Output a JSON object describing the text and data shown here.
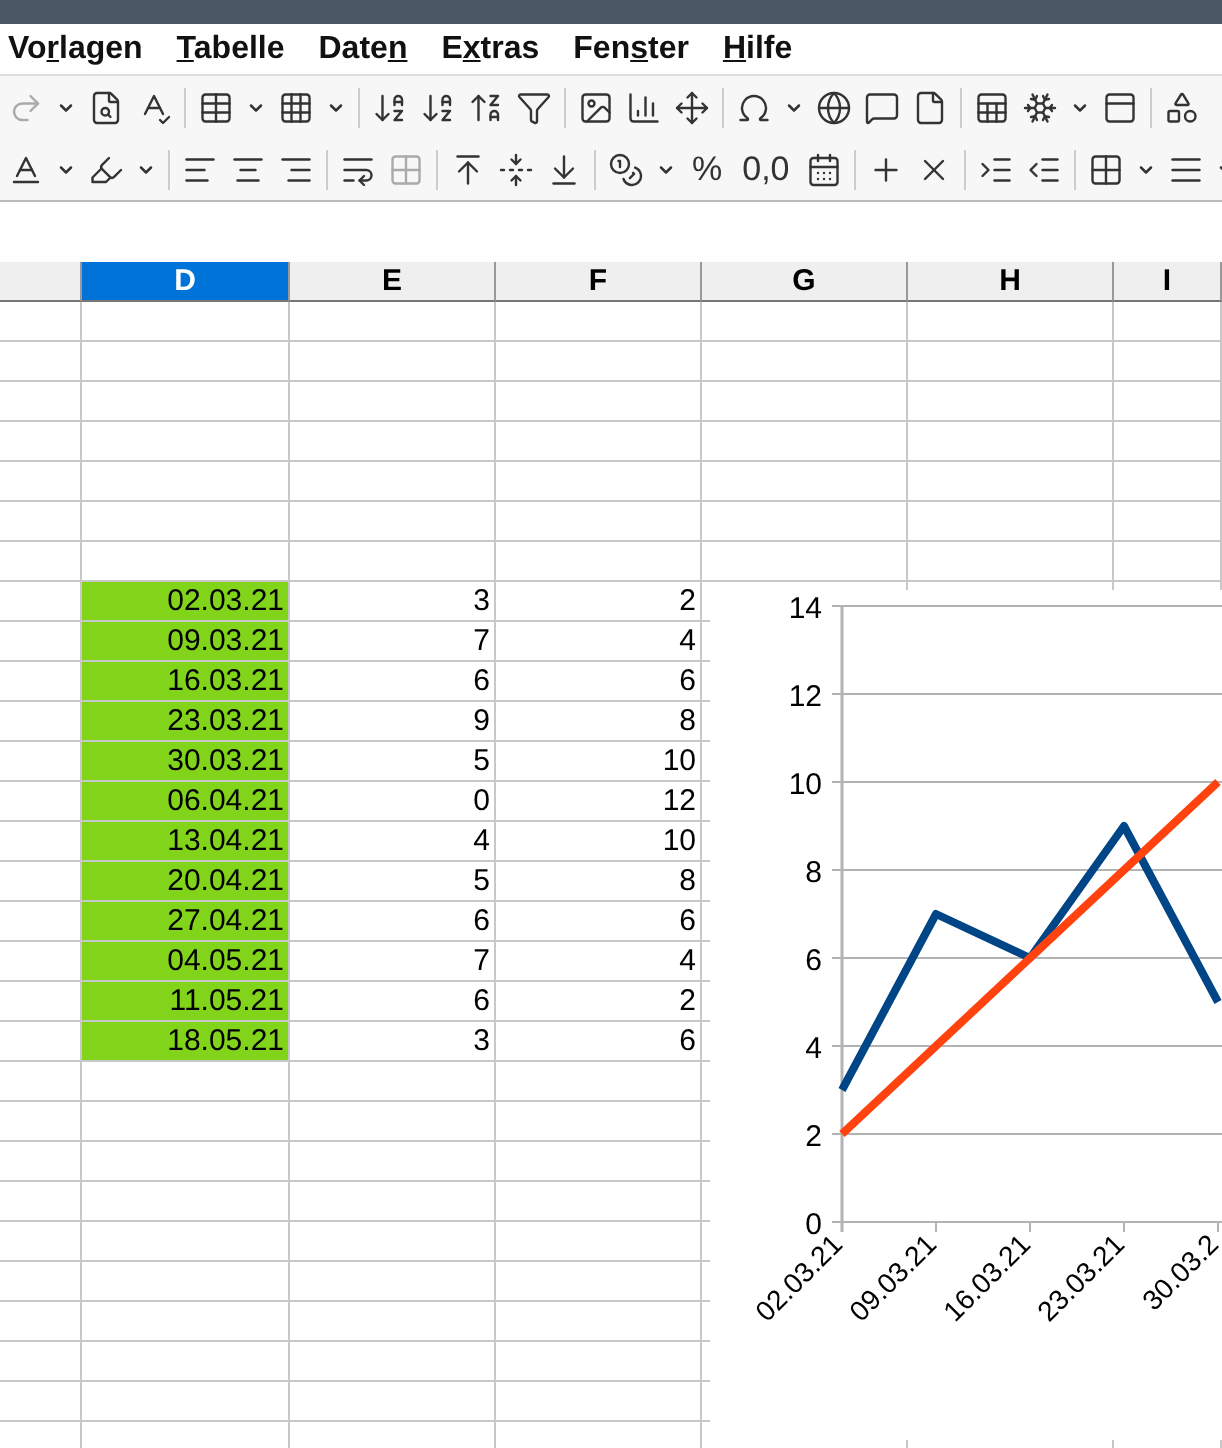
{
  "menu": [
    {
      "before": "Vo",
      "key": "r",
      "after": "lagen"
    },
    {
      "key": "T",
      "after": "abelle"
    },
    {
      "before": "Date",
      "key": "n"
    },
    {
      "before": "E",
      "key": "x",
      "after": "tras"
    },
    {
      "before": "Fen",
      "key": "s",
      "after": "ter"
    },
    {
      "key": "H",
      "after": "ilfe"
    }
  ],
  "toolbar_texts": [
    "%",
    "0,0"
  ],
  "columns": [
    {
      "label": "D",
      "selected": true
    },
    {
      "label": "E",
      "selected": false
    },
    {
      "label": "F",
      "selected": false
    },
    {
      "label": "G",
      "selected": false
    },
    {
      "label": "H",
      "selected": false
    },
    {
      "label": "I",
      "selected": false
    }
  ],
  "rows": [
    {
      "highlighted": true,
      "cells": [
        "02.03.21",
        "3",
        "2"
      ]
    },
    {
      "highlighted": true,
      "cells": [
        "09.03.21",
        "7",
        "4"
      ]
    },
    {
      "highlighted": true,
      "cells": [
        "16.03.21",
        "6",
        "6"
      ]
    },
    {
      "highlighted": true,
      "cells": [
        "23.03.21",
        "9",
        "8"
      ]
    },
    {
      "highlighted": true,
      "cells": [
        "30.03.21",
        "5",
        "10"
      ]
    },
    {
      "highlighted": true,
      "cells": [
        "06.04.21",
        "0",
        "12"
      ]
    },
    {
      "highlighted": true,
      "cells": [
        "13.04.21",
        "4",
        "10"
      ]
    },
    {
      "highlighted": true,
      "cells": [
        "20.04.21",
        "5",
        "8"
      ]
    },
    {
      "highlighted": true,
      "cells": [
        "27.04.21",
        "6",
        "6"
      ]
    },
    {
      "highlighted": true,
      "cells": [
        "04.05.21",
        "7",
        "4"
      ]
    },
    {
      "highlighted": true,
      "cells": [
        "11.05.21",
        "6",
        "2"
      ]
    },
    {
      "highlighted": true,
      "cells": [
        "18.05.21",
        "3",
        "6"
      ]
    }
  ],
  "chart": {
    "chart_data": {
      "type": "line",
      "categories": [
        "02.03.21",
        "09.03.21",
        "16.03.21",
        "23.03.21",
        "30.03.2"
      ],
      "series": [
        {
          "color": "#004586",
          "values": [
            3,
            7,
            6,
            9,
            5
          ]
        },
        {
          "color": "#ff420e",
          "values": [
            2,
            4,
            6,
            8,
            10
          ]
        }
      ],
      "grid": true,
      "ylim": [
        0,
        14
      ],
      "yticks": [
        0,
        2,
        4,
        6,
        8,
        10,
        12,
        14
      ]
    }
  }
}
